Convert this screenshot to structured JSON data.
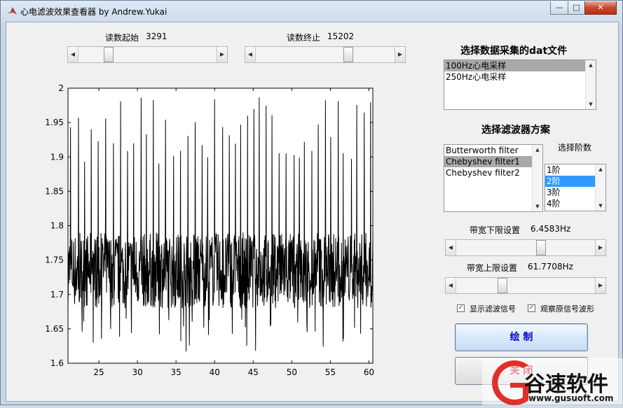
{
  "window": {
    "title": "心电滤波效果查看器 by Andrew.Yukai",
    "controls": [
      "—",
      "□",
      "✕"
    ]
  },
  "read_start": {
    "label": "读数起始",
    "value": "3291",
    "position": 0.2
  },
  "read_end": {
    "label": "读数终止",
    "value": "15202",
    "position": 0.68
  },
  "file_section": {
    "header": "选择数据采集的dat文件",
    "items": [
      "100Hz心电采样",
      "250Hz心电采样"
    ],
    "selected": 0
  },
  "filter_section": {
    "header": "选择滤波器方案",
    "items": [
      "Butterworth filter",
      "Chebyshev filter1",
      "Chebyshev filter2"
    ],
    "selected": 1
  },
  "order_section": {
    "label": "选择阶数",
    "items": [
      "1阶",
      "2阶",
      "3阶",
      "4阶"
    ],
    "selected": 1
  },
  "band_low": {
    "label": "带宽下限设置",
    "value": "6.4583Hz",
    "position": 0.62
  },
  "band_high": {
    "label": "带宽上限设置",
    "value": "61.7708Hz",
    "position": 0.32
  },
  "checkboxes": [
    {
      "label": "显示滤波信号",
      "checked": true
    },
    {
      "label": "观察原信号波形",
      "checked": true
    }
  ],
  "buttons": {
    "draw": "绘 制",
    "close": "关 闭"
  },
  "watermark": {
    "brand": "谷速软件",
    "url": "www.gusuoft.com"
  },
  "chart_data": {
    "type": "line",
    "title": "",
    "xlabel": "",
    "ylabel": "",
    "xlim": [
      21,
      60.5
    ],
    "ylim": [
      1.6,
      2.0
    ],
    "x_ticks": [
      25,
      30,
      35,
      40,
      45,
      50,
      55,
      60
    ],
    "y_ticks": [
      1.6,
      1.65,
      1.7,
      1.75,
      1.8,
      1.85,
      1.9,
      1.95,
      2.0
    ],
    "grid": false,
    "series": [
      {
        "color": "#000000",
        "baseline": 1.73,
        "noise_band": [
          1.68,
          1.79
        ],
        "spike_max": 1.99,
        "spike_interval": 0.85,
        "min": 1.615
      }
    ]
  }
}
